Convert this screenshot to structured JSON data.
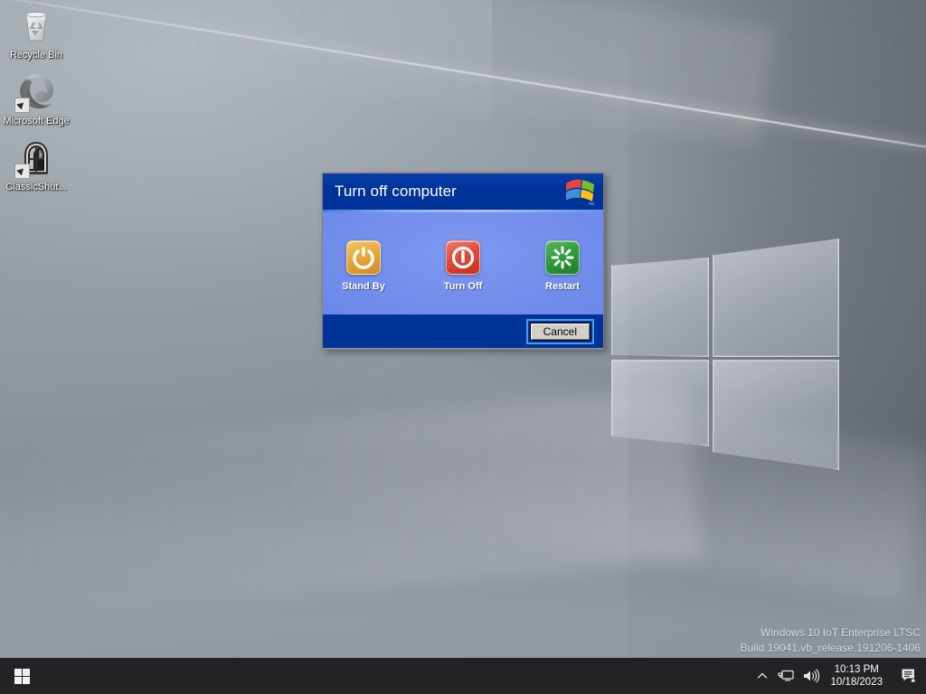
{
  "desktop": {
    "icons": [
      {
        "label": "Recycle Bin",
        "icon": "recycle-bin-icon",
        "shortcut": false
      },
      {
        "label": "Microsoft Edge",
        "icon": "microsoft-edge-icon",
        "shortcut": true
      },
      {
        "label": "ClassicShut...",
        "icon": "classic-shutdown-icon",
        "shortcut": true
      }
    ]
  },
  "dialog": {
    "title": "Turn off computer",
    "logo_tm": "™",
    "options": [
      {
        "label": "Stand By",
        "icon": "standby-power-icon",
        "color": "#e9a83a"
      },
      {
        "label": "Turn Off",
        "icon": "turn-off-power-icon",
        "color": "#e24a36"
      },
      {
        "label": "Restart",
        "icon": "restart-starburst-icon",
        "color": "#2f9e3d"
      }
    ],
    "cancel_label": "Cancel"
  },
  "watermark": {
    "line1": "Windows 10 IoT Enterprise LTSC",
    "line2": "Build 19041.vb_release.191206-1406"
  },
  "taskbar": {
    "start_name": "start-button",
    "tray": {
      "chevron_label": "show-hidden-icons",
      "network_label": "network-icon",
      "volume_label": "volume-icon",
      "action_center_label": "action-center-icon"
    },
    "clock": {
      "time": "10:13 PM",
      "date": "10/18/2023"
    }
  },
  "colors": {
    "xp_title_blue": "#003399",
    "xp_body_blue": "#6f8bea",
    "taskbar": "#232326",
    "accent_focus": "#4b9be8"
  }
}
